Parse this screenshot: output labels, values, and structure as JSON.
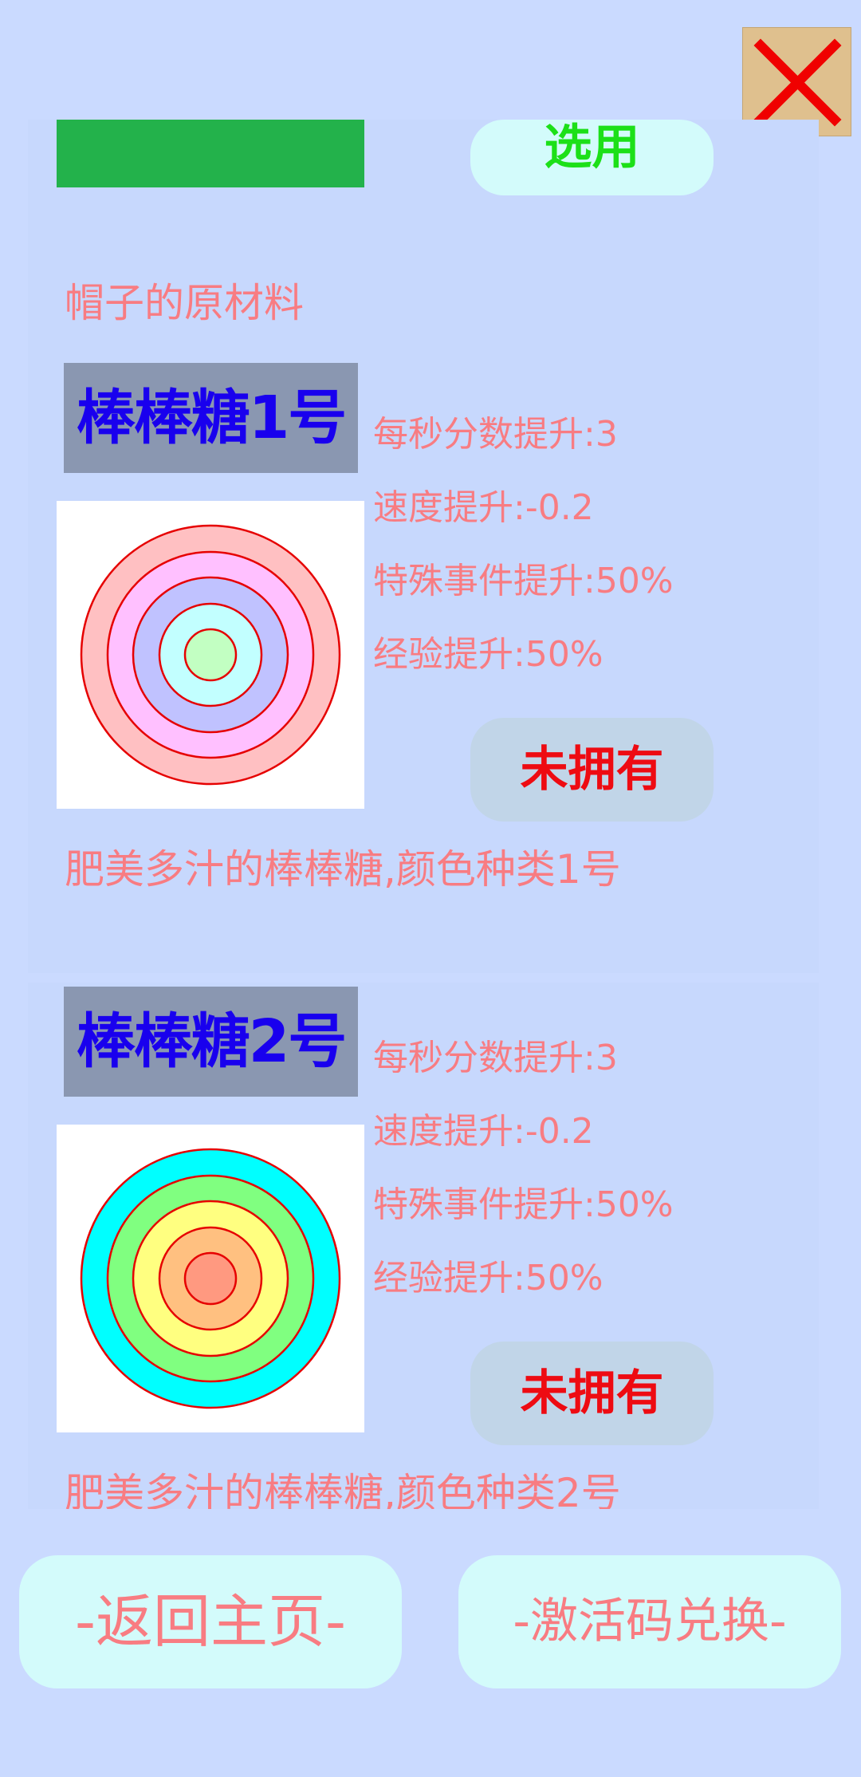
{
  "close": {
    "icon": "close-icon"
  },
  "items": [
    {
      "select_label": "选用",
      "description": "帽子的原材料"
    },
    {
      "title": "棒棒糖1号",
      "stats": [
        "每秒分数提升:3",
        "速度提升:-0.2",
        "特殊事件提升:50%",
        "经验提升:50%"
      ],
      "status_label": "未拥有",
      "description": "肥美多汁的棒棒糖,颜色种类1号",
      "ring_colors": [
        "#ffc0c2",
        "#ffc0ff",
        "#c0c2ff",
        "#c2ffff",
        "#c2ffc2"
      ]
    },
    {
      "title": "棒棒糖2号",
      "stats": [
        "每秒分数提升:3",
        "速度提升:-0.2",
        "特殊事件提升:50%",
        "经验提升:50%"
      ],
      "status_label": "未拥有",
      "description": "肥美多汁的棒棒糖,颜色种类2号",
      "ring_colors": [
        "#00ffff",
        "#80ff80",
        "#ffff80",
        "#ffc080",
        "#ff9980"
      ]
    }
  ],
  "footer": {
    "home_label": "-返回主页-",
    "redeem_label": "-激活码兑换-"
  },
  "colors": {
    "background": "#cadaff",
    "title_text": "#1900ee",
    "stat_text": "#f87c82",
    "not_owned": "#ee0b12",
    "select_text": "#1ce018"
  }
}
